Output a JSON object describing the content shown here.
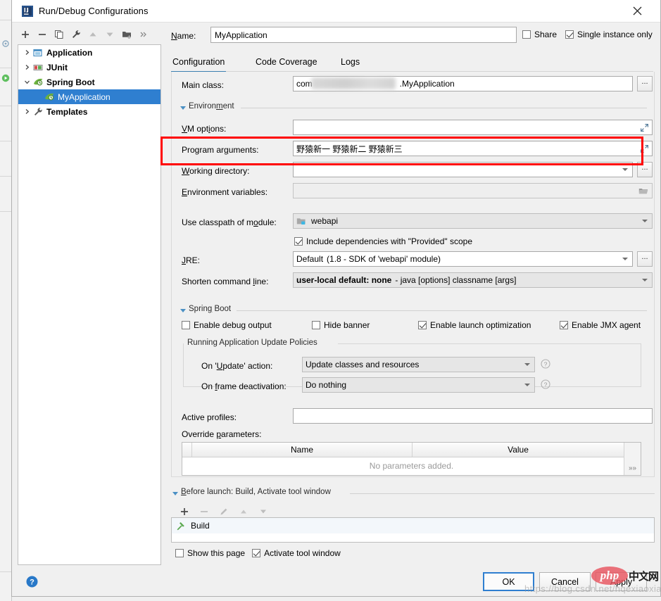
{
  "window": {
    "title": "Run/Debug Configurations",
    "app_icon": "intellij-idea-icon",
    "close_label": "✕"
  },
  "tree_toolbar": {
    "buttons": [
      {
        "name": "add-configuration-button",
        "glyph": "+"
      },
      {
        "name": "remove-configuration-button",
        "glyph": "−"
      },
      {
        "name": "copy-configuration-button",
        "glyph": "copy-icon"
      },
      {
        "name": "edit-templates-button",
        "glyph": "wrench-icon"
      },
      {
        "name": "move-up-button",
        "glyph": "triangle-up-icon"
      },
      {
        "name": "move-down-button",
        "glyph": "triangle-down-icon"
      },
      {
        "name": "create-folder-button",
        "glyph": "folder-add-icon"
      },
      {
        "name": "more-options-button",
        "glyph": "»"
      }
    ]
  },
  "tree": {
    "items": [
      {
        "label": "Application",
        "icon": "application-icon",
        "expander": "collapsed",
        "group": true,
        "selected": false,
        "indent": 0
      },
      {
        "label": "JUnit",
        "icon": "junit-icon",
        "expander": "collapsed",
        "group": true,
        "selected": false,
        "indent": 0
      },
      {
        "label": "Spring Boot",
        "icon": "spring-boot-icon",
        "expander": "expanded",
        "group": true,
        "selected": false,
        "indent": 0
      },
      {
        "label": "MyApplication",
        "icon": "spring-boot-icon",
        "expander": "none",
        "group": false,
        "selected": true,
        "indent": 1
      },
      {
        "label": "Templates",
        "icon": "wrench-icon",
        "expander": "collapsed",
        "group": true,
        "selected": false,
        "indent": 0
      }
    ]
  },
  "name_row": {
    "label": "Name:",
    "value": "MyApplication",
    "placeholder": "",
    "share": {
      "label": "Share",
      "checked": false
    },
    "single_instance": {
      "label": "Single instance only",
      "checked": true
    }
  },
  "tabs": [
    {
      "label": "Configuration",
      "active": true
    },
    {
      "label": "Code Coverage",
      "active": false
    },
    {
      "label": "Logs",
      "active": false
    }
  ],
  "configuration": {
    "main_class": {
      "label": "Main class:",
      "value_prefix": "com",
      "value_suffix": ".MyApplication",
      "redacted": true,
      "browse_label": "..."
    },
    "environment_section": {
      "title": "Environment",
      "expanded": true
    },
    "vm_options": {
      "label": "VM options:",
      "value": "",
      "expand_icon": "expand-editor-icon"
    },
    "program_arguments": {
      "label": "Program arguments:",
      "value": "野猿新一 野猿新二 野猿新三",
      "expand_icon": "expand-editor-icon",
      "highlighted": true,
      "highlight_color": "#ff0000"
    },
    "working_directory": {
      "label": "Working directory:",
      "value": "",
      "browse_label": "..."
    },
    "environment_variables": {
      "label": "Environment variables:",
      "value": "",
      "browse_icon": "folder-icon",
      "disabled": true
    },
    "use_classpath_of_module": {
      "label": "Use classpath of module:",
      "value": "webapi",
      "icon": "module-icon"
    },
    "include_provided": {
      "label": "Include dependencies with \"Provided\" scope",
      "checked": true
    },
    "jre": {
      "label": "JRE:",
      "value": "Default",
      "value_hint": "(1.8 - SDK of 'webapi' module)",
      "browse_label": "..."
    },
    "shorten_command_line": {
      "label": "Shorten command line:",
      "value": "user-local default: none",
      "value_hint": "- java [options] classname [args]"
    },
    "spring_boot_section": {
      "title": "Spring Boot",
      "expanded": true
    },
    "spring_boot_checkboxes": [
      {
        "label": "Enable debug output",
        "checked": false,
        "name": "enable-debug-output-checkbox"
      },
      {
        "label": "Hide banner",
        "checked": false,
        "name": "hide-banner-checkbox"
      },
      {
        "label": "Enable launch optimization",
        "checked": true,
        "name": "enable-launch-optimization-checkbox"
      },
      {
        "label": "Enable JMX agent",
        "checked": true,
        "name": "enable-jmx-agent-checkbox"
      }
    ],
    "update_policies": {
      "title": "Running Application Update Policies",
      "on_update_action": {
        "label": "On 'Update' action:",
        "value": "Update classes and resources",
        "help": "?"
      },
      "on_frame_deactivation": {
        "label": "On frame deactivation:",
        "value": "Do nothing",
        "help": "?"
      }
    },
    "active_profiles": {
      "label": "Active profiles:",
      "value": ""
    },
    "override_parameters": {
      "label": "Override parameters:",
      "columns": [
        "Name",
        "Value"
      ],
      "rows": [],
      "empty_text": "No parameters added.",
      "expand_label": "»»"
    }
  },
  "before_launch": {
    "section_title": "Before launch: Build, Activate tool window",
    "toolbar": [
      {
        "name": "before-launch-add-button",
        "glyph": "+"
      },
      {
        "name": "before-launch-remove-button",
        "glyph": "−"
      },
      {
        "name": "before-launch-edit-button",
        "glyph": "pencil-icon"
      },
      {
        "name": "before-launch-move-up-button",
        "glyph": "triangle-up-icon"
      },
      {
        "name": "before-launch-move-down-button",
        "glyph": "triangle-down-icon"
      }
    ],
    "items": [
      {
        "label": "Build",
        "icon": "build-hammer-icon"
      }
    ]
  },
  "bottom": {
    "show_this_page": {
      "label": "Show this page",
      "checked": false
    },
    "activate_tool_window": {
      "label": "Activate tool window",
      "checked": true
    },
    "ok_label": "OK",
    "cancel_label": "Cancel",
    "apply_label": "Apply",
    "help_icon": "help-icon"
  },
  "watermark": {
    "url": "https://blog.csdn.net/hqexiaoxiao",
    "brand_text": "php",
    "brand_suffix": "中文网"
  }
}
